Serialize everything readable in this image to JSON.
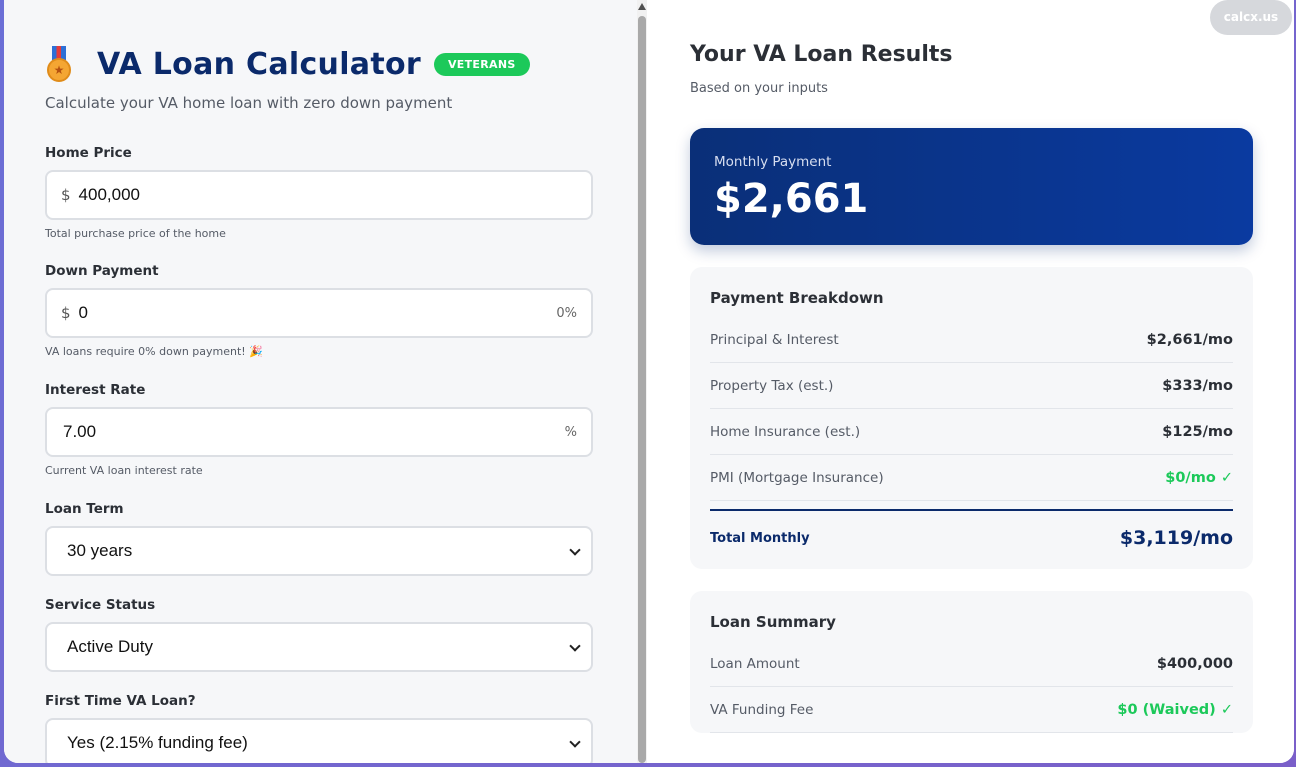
{
  "brand": "calcx.us",
  "calculator": {
    "title": "VA Loan Calculator",
    "badge": "VETERANS",
    "subtitle": "Calculate your VA home loan with zero down payment",
    "icon": "medal-icon"
  },
  "fields": {
    "home_price": {
      "label": "Home Price",
      "prefix": "$",
      "value": "400,000",
      "hint": "Total purchase price of the home"
    },
    "down_payment": {
      "label": "Down Payment",
      "prefix": "$",
      "value": "0",
      "suffix": "0%",
      "hint": "VA loans require 0% down payment! 🎉"
    },
    "interest_rate": {
      "label": "Interest Rate",
      "value": "7.00",
      "suffix": "%",
      "hint": "Current VA loan interest rate"
    },
    "loan_term": {
      "label": "Loan Term",
      "selected": "30 years"
    },
    "service_status": {
      "label": "Service Status",
      "selected": "Active Duty"
    },
    "first_time": {
      "label": "First Time VA Loan?",
      "selected": "Yes (2.15% funding fee)"
    }
  },
  "results": {
    "title": "Your VA Loan Results",
    "subtitle": "Based on your inputs",
    "monthly_label": "Monthly Payment",
    "monthly_value": "$2,661"
  },
  "breakdown": {
    "title": "Payment Breakdown",
    "rows": [
      {
        "label": "Principal & Interest",
        "value": "$2,661/mo"
      },
      {
        "label": "Property Tax (est.)",
        "value": "$333/mo"
      },
      {
        "label": "Home Insurance (est.)",
        "value": "$125/mo"
      },
      {
        "label": "PMI (Mortgage Insurance)",
        "value": "$0/mo ✓"
      }
    ],
    "total_label": "Total Monthly",
    "total_value": "$3,119/mo"
  },
  "summary": {
    "title": "Loan Summary",
    "rows": [
      {
        "label": "Loan Amount",
        "value": "$400,000"
      },
      {
        "label": "VA Funding Fee",
        "value": "$0 (Waived) ✓"
      }
    ]
  },
  "colors": {
    "navy": "#0b2a6b",
    "green": "#1cc95a",
    "card_gradient_start": "#0a2f78",
    "card_gradient_end": "#0a3aa0"
  }
}
